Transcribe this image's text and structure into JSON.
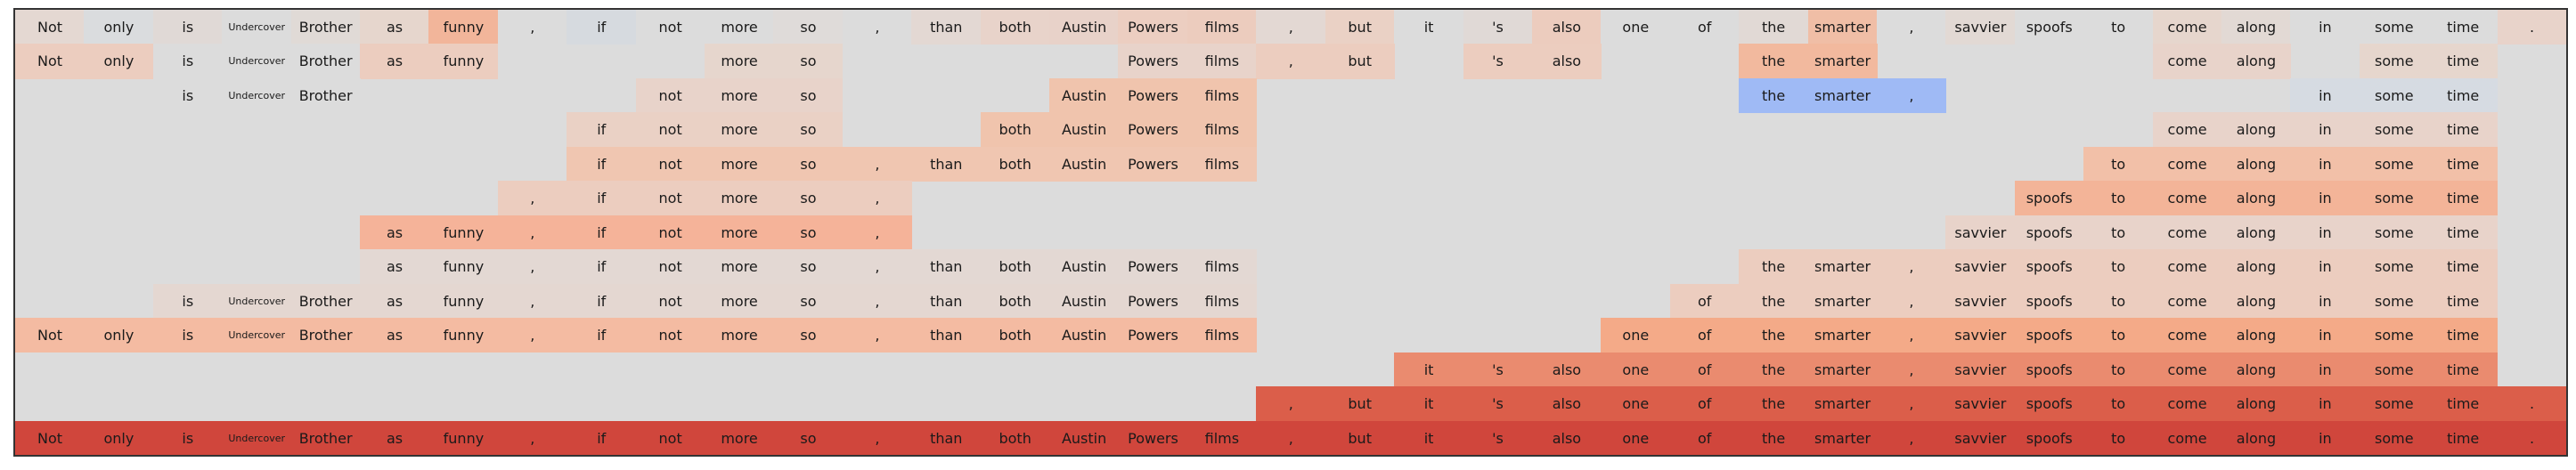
{
  "tokens": [
    "Not",
    "only",
    "is",
    "Undercover",
    "Brother",
    "as",
    "funny",
    ",",
    "if",
    "not",
    "more",
    "so",
    ",",
    "than",
    "both",
    "Austin",
    "Powers",
    "films",
    ",",
    "but",
    "it",
    "'s",
    "also",
    "one",
    "of",
    "the",
    "smarter",
    ",",
    "savvier",
    "spoofs",
    "to",
    "come",
    "along",
    "in",
    "some",
    "time",
    "."
  ],
  "background_color": "#dcdcdc",
  "rows": [
    {
      "spans": [
        {
          "start": 0,
          "end": 36,
          "color": "#dfdbd9"
        },
        {
          "start": 0,
          "end": 0,
          "color": "#e4d8d2"
        },
        {
          "start": 1,
          "end": 1,
          "color": "#dadcde"
        },
        {
          "start": 2,
          "end": 2,
          "color": "#e0d9d6"
        },
        {
          "start": 3,
          "end": 3,
          "color": "#dcdcdc"
        },
        {
          "start": 4,
          "end": 4,
          "color": "#e0dad6"
        },
        {
          "start": 5,
          "end": 5,
          "color": "#e6d6cd"
        },
        {
          "start": 6,
          "end": 6,
          "color": "#f2b59a"
        },
        {
          "start": 7,
          "end": 7,
          "color": "#dcdcdc"
        },
        {
          "start": 8,
          "end": 8,
          "color": "#d6dadf"
        },
        {
          "start": 9,
          "end": 9,
          "color": "#dcdcdc"
        },
        {
          "start": 10,
          "end": 10,
          "color": "#dcdcdc"
        },
        {
          "start": 11,
          "end": 11,
          "color": "#dfdbd9"
        },
        {
          "start": 12,
          "end": 12,
          "color": "#dcdcdc"
        },
        {
          "start": 13,
          "end": 13,
          "color": "#e3d8d3"
        },
        {
          "start": 14,
          "end": 14,
          "color": "#e8d3ca"
        },
        {
          "start": 15,
          "end": 15,
          "color": "#e8d2c9"
        },
        {
          "start": 16,
          "end": 16,
          "color": "#eccec1"
        },
        {
          "start": 17,
          "end": 17,
          "color": "#ecccbe"
        },
        {
          "start": 18,
          "end": 18,
          "color": "#e3d8d3"
        },
        {
          "start": 19,
          "end": 19,
          "color": "#ead1c5"
        },
        {
          "start": 20,
          "end": 20,
          "color": "#dcdcdc"
        },
        {
          "start": 21,
          "end": 21,
          "color": "#e0d9d6"
        },
        {
          "start": 22,
          "end": 22,
          "color": "#ecccbe"
        },
        {
          "start": 23,
          "end": 23,
          "color": "#dcdcdc"
        },
        {
          "start": 24,
          "end": 24,
          "color": "#dcdcdc"
        },
        {
          "start": 25,
          "end": 25,
          "color": "#e1d9d5"
        },
        {
          "start": 26,
          "end": 26,
          "color": "#f0bea6"
        },
        {
          "start": 27,
          "end": 27,
          "color": "#dcdcdc"
        },
        {
          "start": 28,
          "end": 28,
          "color": "#e2d9d4"
        },
        {
          "start": 29,
          "end": 29,
          "color": "#dcdcdc"
        },
        {
          "start": 30,
          "end": 30,
          "color": "#dcdcdc"
        },
        {
          "start": 31,
          "end": 31,
          "color": "#e6d6cd"
        },
        {
          "start": 32,
          "end": 32,
          "color": "#e2d9d4"
        },
        {
          "start": 33,
          "end": 33,
          "color": "#dcdcdc"
        },
        {
          "start": 34,
          "end": 34,
          "color": "#dcdcdc"
        },
        {
          "start": 35,
          "end": 35,
          "color": "#dcdcdc"
        },
        {
          "start": 36,
          "end": 36,
          "color": "#e8d3ca"
        }
      ]
    },
    {
      "spans": [
        {
          "start": 0,
          "end": 1,
          "color": "#eccdbf"
        },
        {
          "start": 2,
          "end": 4,
          "color": "#dcdcdc"
        },
        {
          "start": 5,
          "end": 6,
          "color": "#eccdbf"
        },
        {
          "start": 10,
          "end": 11,
          "color": "#e6d6cd"
        },
        {
          "start": 16,
          "end": 17,
          "color": "#e8d3ca"
        },
        {
          "start": 18,
          "end": 19,
          "color": "#eccdbf"
        },
        {
          "start": 21,
          "end": 22,
          "color": "#eccdbf"
        },
        {
          "start": 25,
          "end": 26,
          "color": "#f2b99e"
        },
        {
          "start": 31,
          "end": 32,
          "color": "#e8d3ca"
        },
        {
          "start": 34,
          "end": 35,
          "color": "#e6d6cd"
        }
      ]
    },
    {
      "spans": [
        {
          "start": 2,
          "end": 4,
          "color": "#dcdcdc"
        },
        {
          "start": 9,
          "end": 11,
          "color": "#e8d3ca"
        },
        {
          "start": 15,
          "end": 17,
          "color": "#f0c4ad"
        },
        {
          "start": 25,
          "end": 27,
          "color": "#9fbaf5"
        },
        {
          "start": 33,
          "end": 35,
          "color": "#d6dbe2"
        }
      ]
    },
    {
      "spans": [
        {
          "start": 8,
          "end": 11,
          "color": "#ead1c5"
        },
        {
          "start": 14,
          "end": 17,
          "color": "#f0c4ad"
        },
        {
          "start": 31,
          "end": 35,
          "color": "#e8d3ca"
        }
      ]
    },
    {
      "spans": [
        {
          "start": 8,
          "end": 17,
          "color": "#f0c6b1"
        },
        {
          "start": 30,
          "end": 35,
          "color": "#f2c0a8"
        }
      ]
    },
    {
      "spans": [
        {
          "start": 7,
          "end": 12,
          "color": "#eccdbf"
        },
        {
          "start": 29,
          "end": 35,
          "color": "#f3b498"
        }
      ]
    },
    {
      "spans": [
        {
          "start": 5,
          "end": 12,
          "color": "#f5b399"
        },
        {
          "start": 28,
          "end": 35,
          "color": "#e8d3ca"
        }
      ]
    },
    {
      "spans": [
        {
          "start": 5,
          "end": 17,
          "color": "#e3d8d3"
        },
        {
          "start": 25,
          "end": 35,
          "color": "#eccdbf"
        }
      ]
    },
    {
      "spans": [
        {
          "start": 2,
          "end": 17,
          "color": "#e4d7d1"
        },
        {
          "start": 24,
          "end": 35,
          "color": "#eccdbf"
        }
      ]
    },
    {
      "spans": [
        {
          "start": 0,
          "end": 17,
          "color": "#f4bba2"
        },
        {
          "start": 23,
          "end": 35,
          "color": "#f4aa88"
        }
      ]
    },
    {
      "spans": [
        {
          "start": 20,
          "end": 35,
          "color": "#ea8b6f"
        }
      ]
    },
    {
      "spans": [
        {
          "start": 18,
          "end": 36,
          "color": "#db5e4a"
        }
      ]
    },
    {
      "spans": [
        {
          "start": 0,
          "end": 36,
          "color": "#d0463c"
        }
      ]
    }
  ]
}
